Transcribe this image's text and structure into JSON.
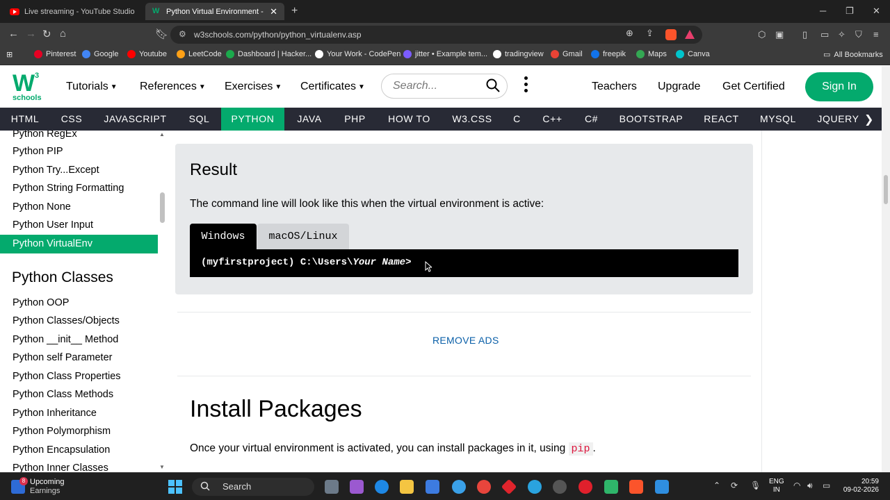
{
  "browser": {
    "tabs": [
      {
        "title": "Live streaming - YouTube Studio"
      },
      {
        "title": "Python Virtual Environment - ver"
      }
    ],
    "url": "w3schools.com/python/python_virtualenv.asp",
    "new_tab": "+",
    "bookmarks": [
      {
        "label": "Pinterest",
        "color": "#e60023"
      },
      {
        "label": "Google",
        "color": "#4285f4"
      },
      {
        "label": "Youtube",
        "color": "#ff0000"
      },
      {
        "label": "LeetCode",
        "color": "#ffa116"
      },
      {
        "label": "Dashboard | Hacker...",
        "color": "#1ba94c"
      },
      {
        "label": "Your Work - CodePen",
        "color": "#ffffff"
      },
      {
        "label": "jitter • Example tem...",
        "color": "#7b5cff"
      },
      {
        "label": "tradingview",
        "color": "#ffffff"
      },
      {
        "label": "Gmail",
        "color": "#ea4335"
      },
      {
        "label": "freepik",
        "color": "#1273eb"
      },
      {
        "label": "Maps",
        "color": "#34a853"
      },
      {
        "label": "Canva",
        "color": "#00c4cc"
      }
    ],
    "all_bookmarks": "All Bookmarks"
  },
  "header": {
    "logo_w": "W",
    "logo_sup": "3",
    "logo_schools": "schools",
    "menus": [
      "Tutorials",
      "References",
      "Exercises",
      "Certificates"
    ],
    "search_placeholder": "Search...",
    "links": [
      "Teachers",
      "Upgrade",
      "Get Certified"
    ],
    "sign_in": "Sign In"
  },
  "topics": [
    "HTML",
    "CSS",
    "JAVASCRIPT",
    "SQL",
    "PYTHON",
    "JAVA",
    "PHP",
    "HOW TO",
    "W3.CSS",
    "C",
    "C++",
    "C#",
    "BOOTSTRAP",
    "REACT",
    "MYSQL",
    "JQUERY"
  ],
  "active_topic": "PYTHON",
  "sidebar": {
    "items_top": [
      "Python RegEx",
      "Python PIP",
      "Python Try...Except",
      "Python String Formatting",
      "Python None",
      "Python User Input",
      "Python VirtualEnv"
    ],
    "active_item": "Python VirtualEnv",
    "section_heading": "Python Classes",
    "items_bottom": [
      "Python OOP",
      "Python Classes/Objects",
      "Python __init__ Method",
      "Python self Parameter",
      "Python Class Properties",
      "Python Class Methods",
      "Python Inheritance",
      "Python Polymorphism",
      "Python Encapsulation",
      "Python Inner Classes"
    ]
  },
  "content": {
    "result_title": "Result",
    "result_desc": "The command line will look like this when the virtual environment is active:",
    "os_tabs": [
      "Windows",
      "macOS/Linux"
    ],
    "console_prefix": "(myfirstproject) C:\\Users\\",
    "console_italic": "Your Name",
    "console_suffix": ">",
    "remove_ads": "REMOVE ADS",
    "heading": "Install Packages",
    "para_before": "Once your virtual environment is activated, you can install packages in it, using ",
    "para_code": "pip",
    "para_after": "."
  },
  "taskbar": {
    "weather_badge": "8",
    "weather_title": "Upcoming",
    "weather_sub": "Earnings",
    "search": "Search",
    "lang_top": "ENG",
    "lang_bottom": "IN",
    "time": "20:59",
    "date": "09-02-2026"
  },
  "colors": {
    "brand_green": "#04aa6d",
    "topics_bg": "#282a35",
    "result_bg": "#e7e9eb",
    "code_red": "#dc143c"
  }
}
